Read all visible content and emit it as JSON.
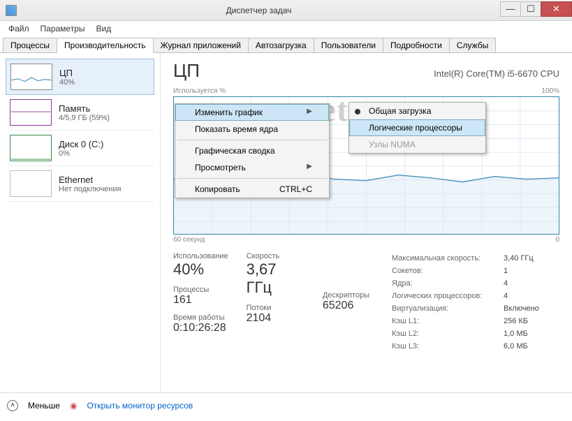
{
  "window": {
    "title": "Диспетчер задач"
  },
  "menu": {
    "file": "Файл",
    "options": "Параметры",
    "view": "Вид"
  },
  "tabs": {
    "processes": "Процессы",
    "performance": "Производительность",
    "apphist": "Журнал приложений",
    "startup": "Автозагрузка",
    "users": "Пользователи",
    "details": "Подробности",
    "services": "Службы"
  },
  "sidebar": {
    "cpu": {
      "title": "ЦП",
      "sub": "40%"
    },
    "mem": {
      "title": "Память",
      "sub": "4/5,9 ГБ (59%)"
    },
    "disk": {
      "title": "Диск 0 (C:)",
      "sub": "0%"
    },
    "eth": {
      "title": "Ethernet",
      "sub": "Нет подключения"
    }
  },
  "header": {
    "title": "ЦП",
    "model": "Intel(R) Core(TM) i5-6670 CPU"
  },
  "chart": {
    "ylabel": "Используется %",
    "ymax": "100%",
    "xmin": "60 секунд",
    "xmax": "0"
  },
  "chart_data": {
    "type": "line",
    "title": "Используется %",
    "xlabel": "60 секунд",
    "ylabel": "Используется %",
    "ylim": [
      0,
      100
    ],
    "x": [
      0,
      5,
      10,
      15,
      20,
      25,
      30,
      35,
      40,
      45,
      50,
      55,
      60
    ],
    "values": [
      40,
      42,
      38,
      41,
      45,
      40,
      39,
      43,
      41,
      38,
      42,
      40,
      41
    ]
  },
  "stats": {
    "util_lbl": "Использование",
    "util_val": "40%",
    "speed_lbl": "Скорость",
    "speed_val": "3,67 ГГц",
    "proc_lbl": "Процессы",
    "proc_val": "161",
    "thr_lbl": "Потоки",
    "thr_val": "2104",
    "hnd_lbl": "Дескрипторы",
    "hnd_val": "65206",
    "up_lbl": "Время работы",
    "up_val": "0:10:26:28"
  },
  "info": {
    "maxspeed_k": "Максимальная скорость:",
    "maxspeed_v": "3,40 ГГц",
    "sockets_k": "Сокетов:",
    "sockets_v": "1",
    "cores_k": "Ядра:",
    "cores_v": "4",
    "lproc_k": "Логических процессоров:",
    "lproc_v": "4",
    "virt_k": "Виртуализация:",
    "virt_v": "Включено",
    "l1_k": "Кэш L1:",
    "l1_v": "256 КБ",
    "l2_k": "Кэш L2:",
    "l2_v": "1,0 МБ",
    "l3_k": "Кэш L3:",
    "l3_v": "6,0 МБ"
  },
  "context": {
    "change_graph": "Изменить график",
    "show_kernel": "Показать время ядра",
    "graph_summary": "Графическая сводка",
    "view": "Просмотреть",
    "copy": "Копировать",
    "copy_sc": "CTRL+C",
    "sub_overall": "Общая загрузка",
    "sub_logical": "Логические процессоры",
    "sub_numa": "Узлы NUMA"
  },
  "footer": {
    "fewer": "Меньше",
    "resmon": "Открыть монитор ресурсов"
  },
  "watermark": "set-os.ru"
}
